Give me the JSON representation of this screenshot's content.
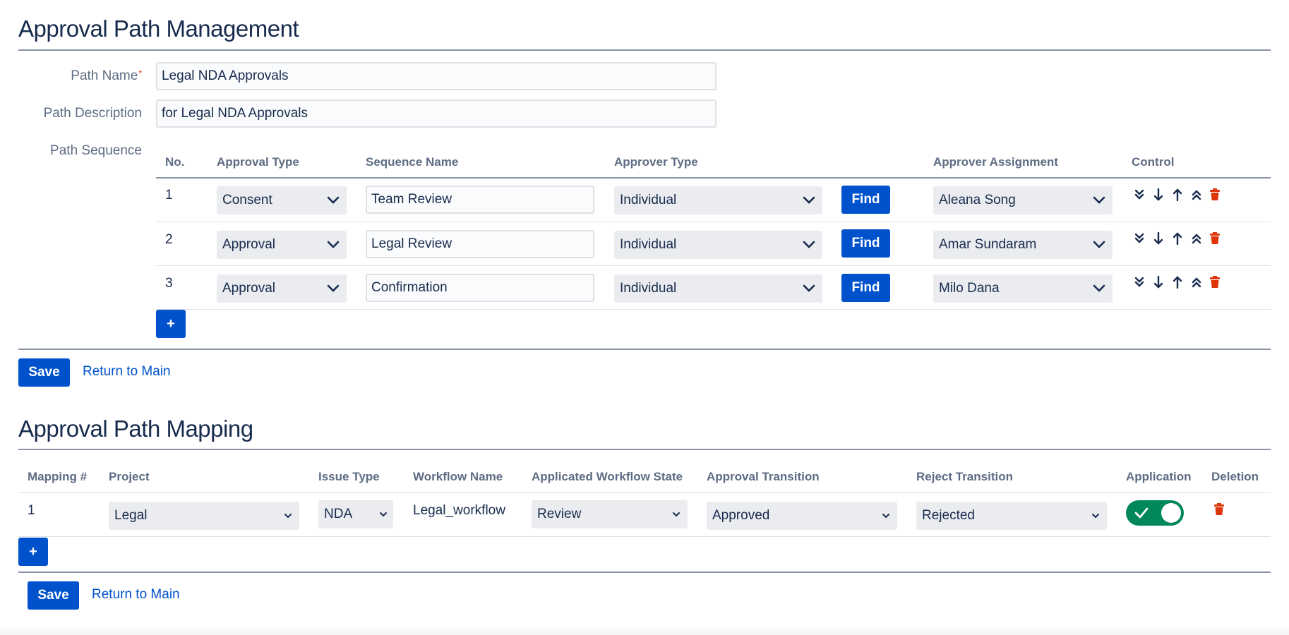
{
  "management": {
    "title": "Approval Path Management",
    "path_name_label": "Path Name",
    "required_mark": "*",
    "path_name_value": "Legal NDA Approvals",
    "path_description_label": "Path Description",
    "path_description_value": "for Legal NDA Approvals",
    "path_sequence_label": "Path Sequence",
    "columns": {
      "no": "No.",
      "approval_type": "Approval Type",
      "sequence_name": "Sequence Name",
      "approver_type": "Approver Type",
      "approver_assignment": "Approver Assignment",
      "control": "Control"
    },
    "rows": [
      {
        "no": "1",
        "approval_type": "Consent",
        "sequence_name": "Team Review",
        "approver_type": "Individual",
        "find_label": "Find",
        "approver": "Aleana Song"
      },
      {
        "no": "2",
        "approval_type": "Approval",
        "sequence_name": "Legal Review",
        "approver_type": "Individual",
        "find_label": "Find",
        "approver": "Amar Sundaram"
      },
      {
        "no": "3",
        "approval_type": "Approval",
        "sequence_name": "Confirmation",
        "approver_type": "Individual",
        "find_label": "Find",
        "approver": "Milo Dana"
      }
    ],
    "add_label": "+",
    "save_label": "Save",
    "return_label": "Return to Main"
  },
  "mapping": {
    "title": "Approval Path Mapping",
    "columns": {
      "mapping_no": "Mapping #",
      "project": "Project",
      "issue_type": "Issue Type",
      "workflow_name": "Workflow Name",
      "workflow_state": "Applicated Workflow State",
      "approval_transition": "Approval Transition",
      "reject_transition": "Reject Transition",
      "application": "Application",
      "deletion": "Deletion"
    },
    "rows": [
      {
        "mapping_no": "1",
        "project": "Legal",
        "issue_type": "NDA",
        "workflow_name": "Legal_workflow",
        "workflow_state": "Review",
        "approval_transition": "Approved",
        "reject_transition": "Rejected",
        "application_enabled": true
      }
    ],
    "add_label": "+",
    "save_label": "Save",
    "return_label": "Return to Main"
  },
  "colors": {
    "primary": "#0052cc",
    "toggle_on": "#00875a",
    "delete": "#de350b",
    "heading": "#172b4d",
    "label": "#5e6c84"
  }
}
